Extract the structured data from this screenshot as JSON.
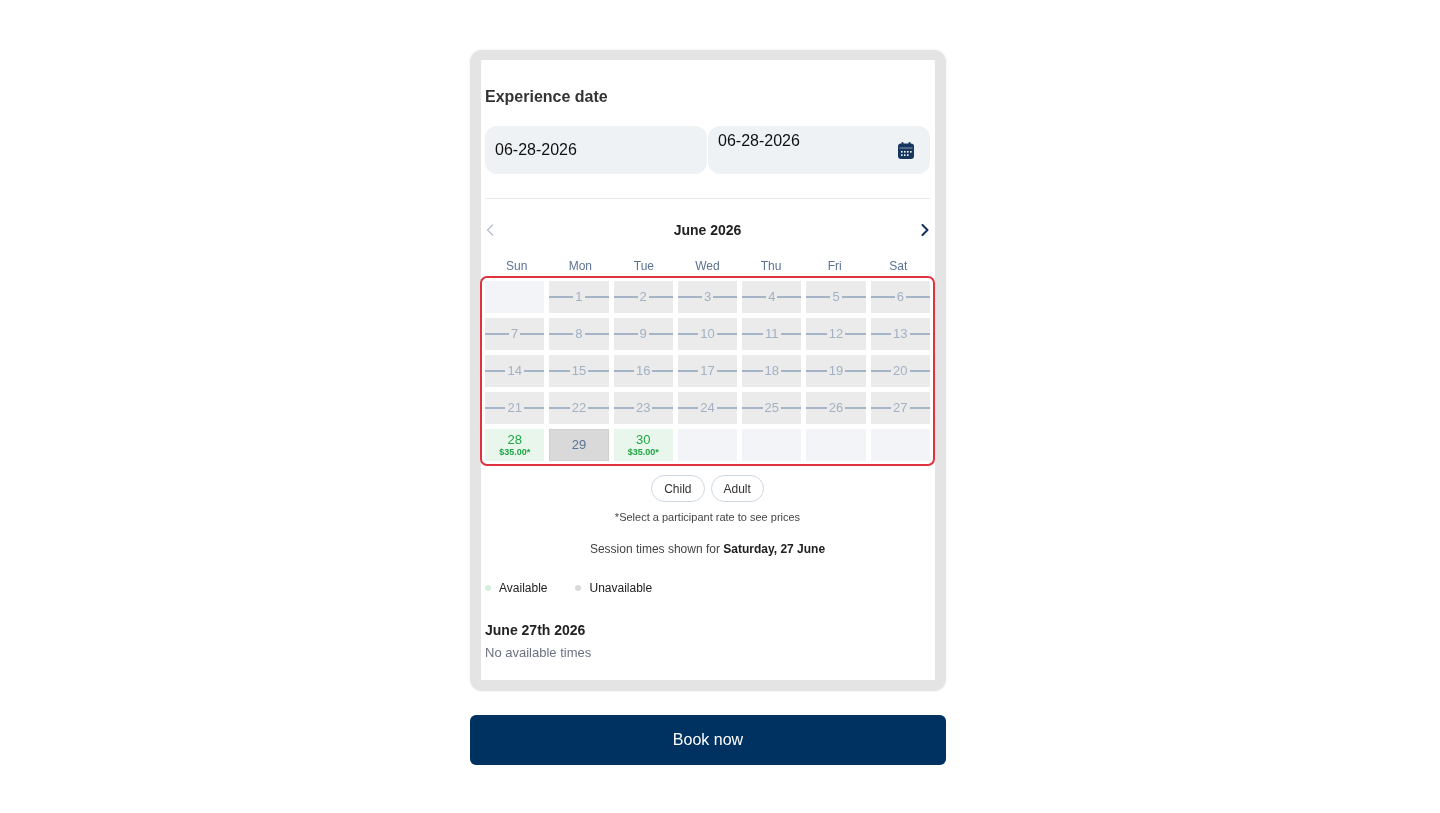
{
  "section_title": "Experience date",
  "date_fields": [
    {
      "value": "06-28-2026",
      "has_calendar_icon": false
    },
    {
      "value": "06-28-2026",
      "has_calendar_icon": true
    }
  ],
  "calendar": {
    "month": "June 2026",
    "prev_disabled": true,
    "next_disabled": false,
    "error_outline": true,
    "weekdays": [
      "Sun",
      "Mon",
      "Tue",
      "Wed",
      "Thu",
      "Fri",
      "Sat"
    ],
    "days": [
      {
        "kind": "blank"
      },
      {
        "kind": "past",
        "label": "1"
      },
      {
        "kind": "past",
        "label": "2"
      },
      {
        "kind": "past",
        "label": "3"
      },
      {
        "kind": "past",
        "label": "4"
      },
      {
        "kind": "past",
        "label": "5"
      },
      {
        "kind": "past",
        "label": "6"
      },
      {
        "kind": "past",
        "label": "7"
      },
      {
        "kind": "past",
        "label": "8"
      },
      {
        "kind": "past",
        "label": "9"
      },
      {
        "kind": "past",
        "label": "10"
      },
      {
        "kind": "past",
        "label": "11"
      },
      {
        "kind": "past",
        "label": "12"
      },
      {
        "kind": "past",
        "label": "13"
      },
      {
        "kind": "past",
        "label": "14"
      },
      {
        "kind": "past",
        "label": "15"
      },
      {
        "kind": "past",
        "label": "16"
      },
      {
        "kind": "past",
        "label": "17"
      },
      {
        "kind": "past",
        "label": "18"
      },
      {
        "kind": "past",
        "label": "19"
      },
      {
        "kind": "past",
        "label": "20"
      },
      {
        "kind": "past",
        "label": "21"
      },
      {
        "kind": "past",
        "label": "22"
      },
      {
        "kind": "past",
        "label": "23"
      },
      {
        "kind": "past",
        "label": "24"
      },
      {
        "kind": "past",
        "label": "25"
      },
      {
        "kind": "past",
        "label": "26"
      },
      {
        "kind": "past",
        "label": "27"
      },
      {
        "kind": "available",
        "label": "28",
        "price": "$35.00*"
      },
      {
        "kind": "unavailable",
        "label": "29"
      },
      {
        "kind": "available",
        "label": "30",
        "price": "$35.00*"
      },
      {
        "kind": "blank"
      },
      {
        "kind": "blank"
      },
      {
        "kind": "blank"
      },
      {
        "kind": "blank"
      }
    ]
  },
  "rates": [
    {
      "label": "Child",
      "selected": false
    },
    {
      "label": "Adult",
      "selected": false
    }
  ],
  "rate_hint": "*Select a participant rate to see prices",
  "session_note": "Session times shown for **Saturday, 27 June**",
  "legend": [
    {
      "label": "Available",
      "color": "#d4efdc"
    },
    {
      "label": "Unavailable",
      "color": "#d9d9d9"
    }
  ],
  "sessions": {
    "date": "June 27th 2026",
    "empty_message": "No available times"
  },
  "book_button": "Book now"
}
